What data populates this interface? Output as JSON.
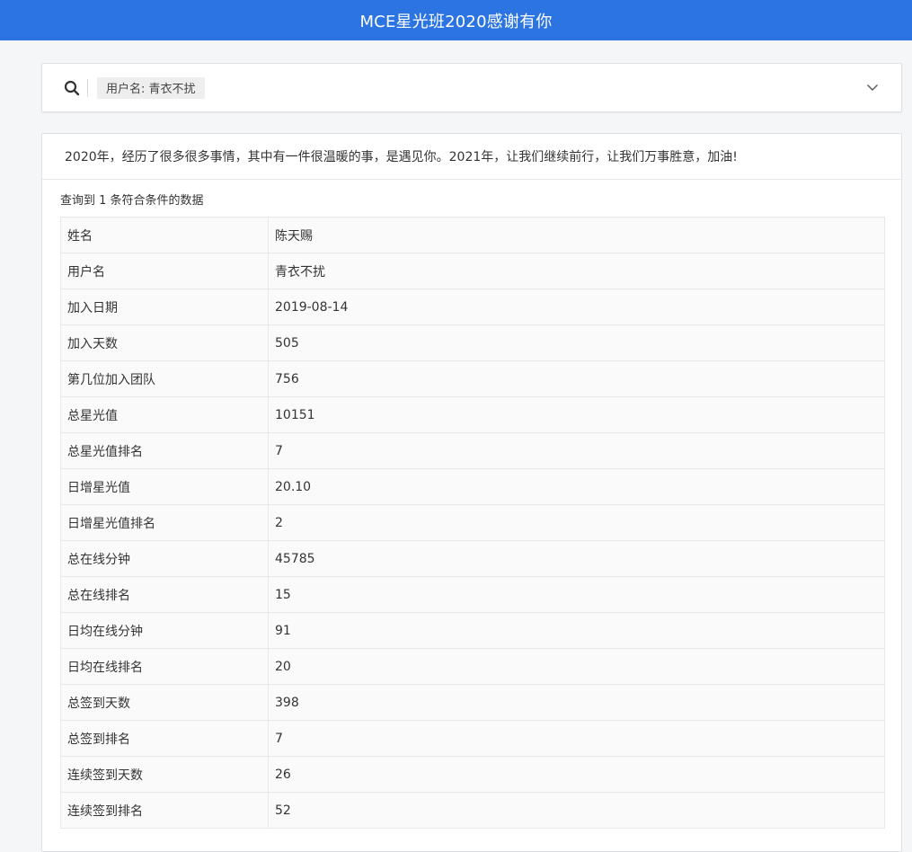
{
  "header": {
    "title": "MCE星光班2020感谢有你"
  },
  "search": {
    "icon": "search-icon",
    "filter_tag": "用户名: 青衣不扰",
    "toggle_icon": "chevron-down-icon"
  },
  "card": {
    "message": "2020年，经历了很多很多事情，其中有一件很温暖的事，是遇见你。2021年，让我们继续前行，让我们万事胜意，加油!",
    "result_count": "查询到 1 条符合条件的数据"
  },
  "details": [
    {
      "label": "姓名",
      "value": "陈天赐"
    },
    {
      "label": "用户名",
      "value": "青衣不扰"
    },
    {
      "label": "加入日期",
      "value": "2019-08-14"
    },
    {
      "label": "加入天数",
      "value": "505"
    },
    {
      "label": "第几位加入团队",
      "value": "756"
    },
    {
      "label": "总星光值",
      "value": "10151"
    },
    {
      "label": "总星光值排名",
      "value": "7"
    },
    {
      "label": "日增星光值",
      "value": "20.10"
    },
    {
      "label": "日增星光值排名",
      "value": "2"
    },
    {
      "label": "总在线分钟",
      "value": "45785"
    },
    {
      "label": "总在线排名",
      "value": "15"
    },
    {
      "label": "日均在线分钟",
      "value": "91"
    },
    {
      "label": "日均在线排名",
      "value": "20"
    },
    {
      "label": "总签到天数",
      "value": "398"
    },
    {
      "label": "总签到排名",
      "value": "7"
    },
    {
      "label": "连续签到天数",
      "value": "26"
    },
    {
      "label": "连续签到排名",
      "value": "52"
    }
  ]
}
